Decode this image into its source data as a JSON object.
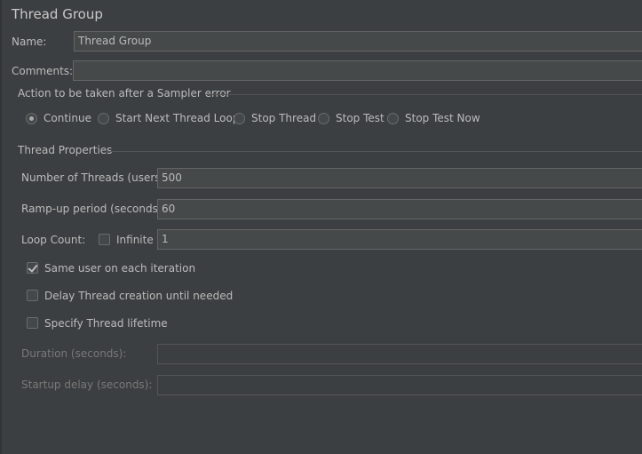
{
  "panel": {
    "title": "Thread Group"
  },
  "name": {
    "label": "Name:",
    "value": "Thread Group"
  },
  "comments": {
    "label": "Comments:",
    "value": ""
  },
  "sampler_error": {
    "title": "Action to be taken after a Sampler error",
    "options": [
      {
        "label": "Continue",
        "selected": true
      },
      {
        "label": "Start Next Thread Loop",
        "selected": false
      },
      {
        "label": "Stop Thread",
        "selected": false
      },
      {
        "label": "Stop Test",
        "selected": false
      },
      {
        "label": "Stop Test Now",
        "selected": false
      }
    ]
  },
  "thread_properties": {
    "title": "Thread Properties",
    "num_threads": {
      "label": "Number of Threads (users):",
      "value": "500"
    },
    "ramp_up": {
      "label": "Ramp-up period (seconds):",
      "value": "60"
    },
    "loop_count": {
      "label": "Loop Count:",
      "infinite_label": "Infinite",
      "infinite": false,
      "value": "1"
    },
    "same_user": {
      "label": "Same user on each iteration",
      "checked": true
    },
    "delay_thread": {
      "label": "Delay Thread creation until needed",
      "checked": false
    },
    "specify_lifetime": {
      "label": "Specify Thread lifetime",
      "checked": false
    },
    "duration": {
      "label": "Duration (seconds):",
      "value": ""
    },
    "startup_delay": {
      "label": "Startup delay (seconds):",
      "value": ""
    }
  }
}
